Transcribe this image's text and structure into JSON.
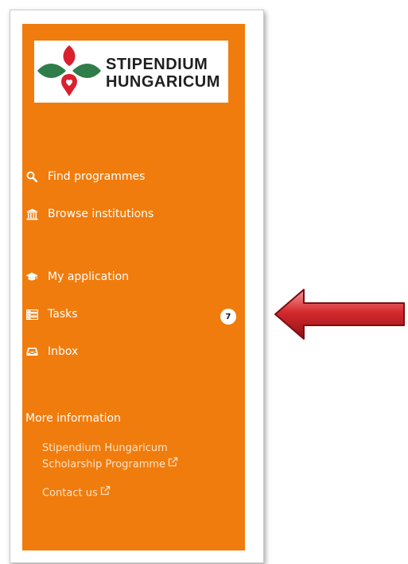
{
  "brand": {
    "line1": "STIPENDIUM",
    "line2": "HUNGARICUM",
    "colors": {
      "panel": "#f07c0d",
      "logo_green": "#2f7d4a",
      "logo_red": "#d9202f",
      "arrow": "#c81f24"
    }
  },
  "nav": {
    "items": [
      {
        "label": "Find programmes",
        "icon": "search-icon"
      },
      {
        "label": "Browse institutions",
        "icon": "institution-icon"
      },
      {
        "label": "My application",
        "icon": "graduation-cap-icon"
      },
      {
        "label": "Tasks",
        "icon": "tasks-list-icon",
        "badge": "7"
      },
      {
        "label": "Inbox",
        "icon": "inbox-icon"
      }
    ]
  },
  "more_info": {
    "title": "More information",
    "links": [
      {
        "line1": "Stipendium Hungaricum",
        "line2": "Scholarship Programme",
        "icon": "external-link-icon"
      },
      {
        "line1": "Contact us",
        "icon": "external-link-icon"
      }
    ]
  },
  "annotation": {
    "icon": "arrow-left-icon"
  }
}
